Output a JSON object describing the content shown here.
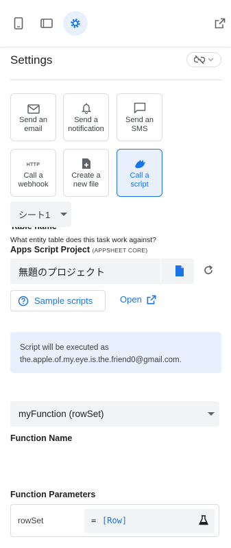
{
  "toolbar": {
    "icons": [
      "phone-icon",
      "tablet-icon",
      "settings-gear-icon",
      "open-in-new-icon"
    ],
    "active": "settings-gear-icon"
  },
  "settings": {
    "title": "Settings",
    "link_toggle_icon": "link-off-icon"
  },
  "tasks": [
    {
      "icon": "email-icon",
      "label": "Send an\nemail",
      "selected": false
    },
    {
      "icon": "bell-icon",
      "label": "Send a\nnotification",
      "selected": false
    },
    {
      "icon": "chat-icon",
      "label": "Send an\nSMS",
      "selected": false
    },
    {
      "icon": "http-icon",
      "icon_text": "HTTP",
      "label": "Call a\nwebhook",
      "selected": false
    },
    {
      "icon": "file-add-icon",
      "label": "Create a\nnew file",
      "selected": false
    },
    {
      "icon": "script-icon",
      "label": "Call a\nscript",
      "selected": true
    }
  ],
  "table": {
    "label": "Table name",
    "helper": "What entity table does this task work against?",
    "value": "シート1"
  },
  "project": {
    "label": "Apps Script Project",
    "sublabel": "(APPSHEET CORE)",
    "value": "無題のプロジェクト",
    "sample_label": "Sample scripts",
    "open_label": "Open"
  },
  "info": {
    "line1": "Script will be executed as",
    "line2": "the.apple.of.my.eye.is.the.friend0@gmail.com."
  },
  "function": {
    "label": "Function Name",
    "value": "myFunction (rowSet)"
  },
  "params": {
    "label": "Function Parameters",
    "name": "rowSet",
    "eq": "=",
    "expr": "[Row]"
  },
  "colors": {
    "accent": "#1a73e8",
    "accent_bg": "#e8f0fe",
    "field_bg": "#f1f3f4"
  }
}
